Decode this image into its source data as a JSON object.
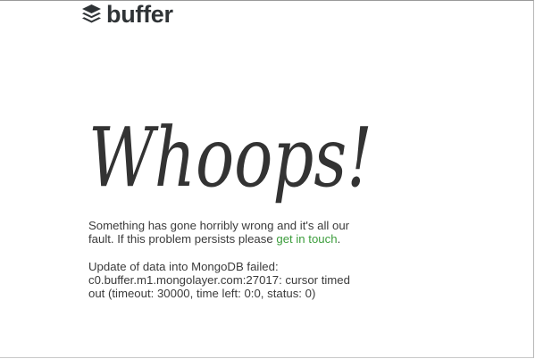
{
  "header": {
    "logo_text": "buffer",
    "logo_icon": "stacked-layers-icon"
  },
  "main": {
    "headline": "Whoops!",
    "message_before_link": "Something has gone horribly wrong and it's all our fault. If this problem persists please ",
    "link_text": "get in touch",
    "message_after_link": ".",
    "error_detail": "Update of data into MongoDB failed: c0.buffer.m1.mongolayer.com:27017: cursor timed out (timeout: 30000, time left: 0:0, status: 0)"
  },
  "colors": {
    "text": "#3b3b3b",
    "link": "#3c9d3c",
    "logo": "#2f3336"
  }
}
